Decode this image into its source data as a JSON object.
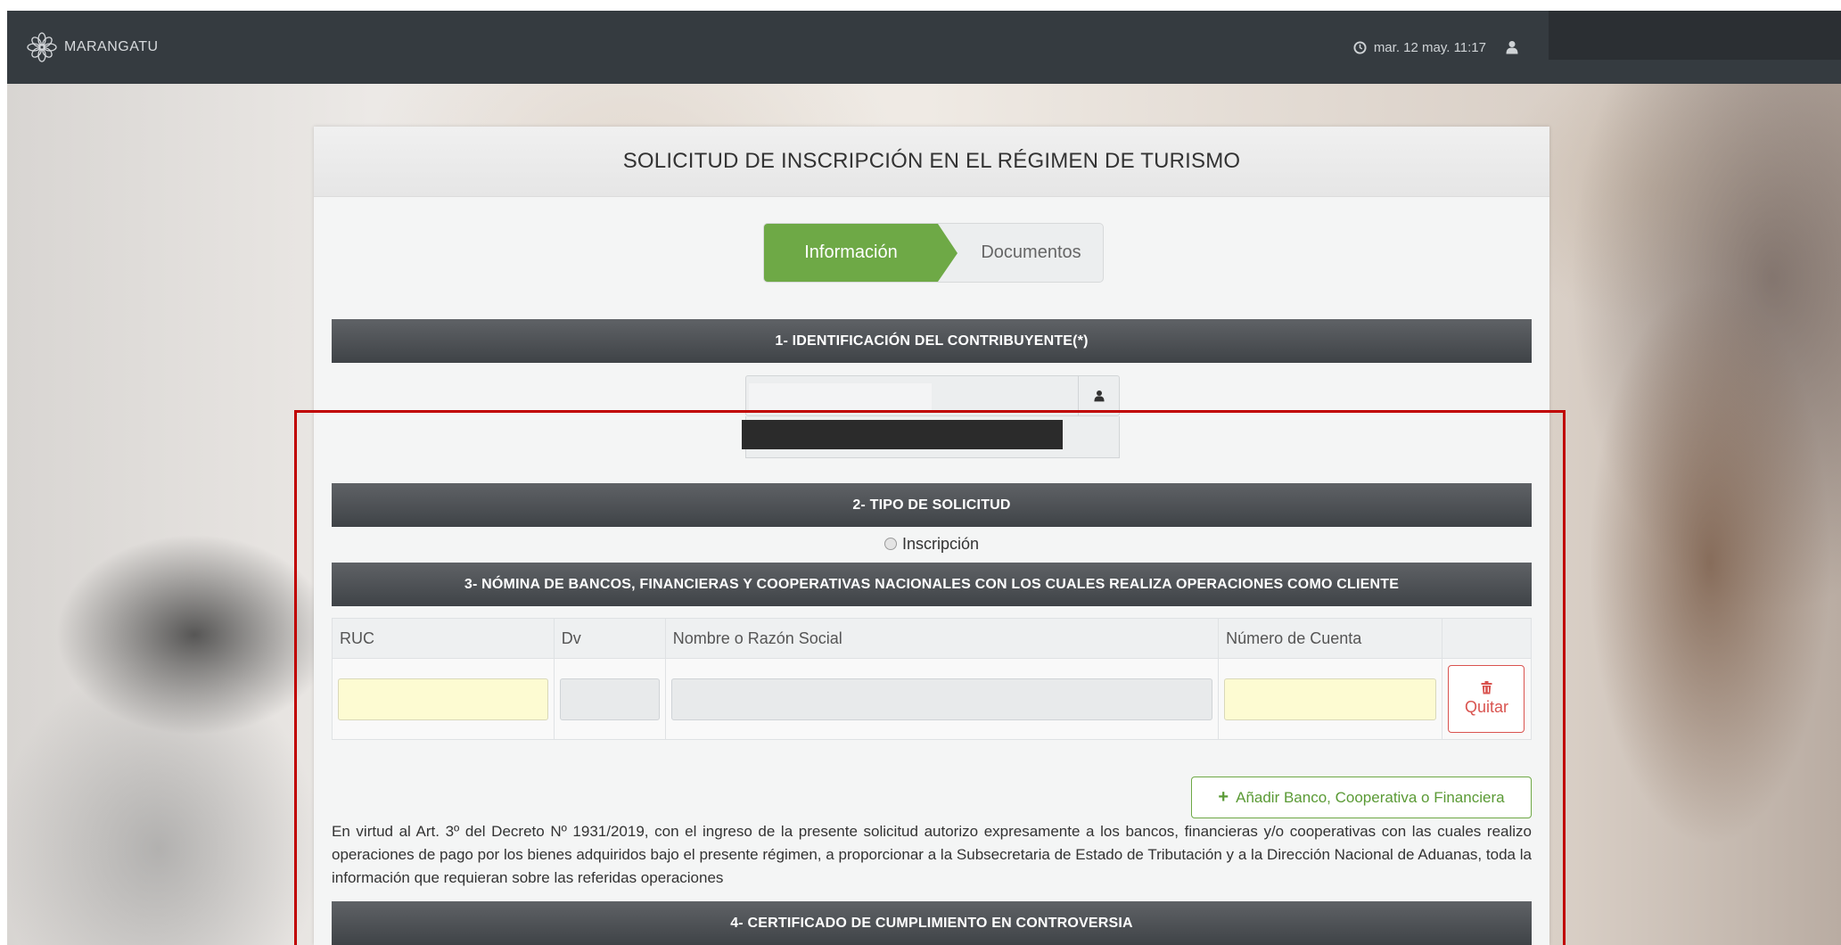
{
  "app": {
    "brand": "MARANGATU"
  },
  "header": {
    "datetime": "mar. 12 may. 11:17"
  },
  "form": {
    "title": "SOLICITUD DE INSCRIPCIÓN EN EL RÉGIMEN DE TURISMO",
    "steps": [
      {
        "label": "Información",
        "active": true
      },
      {
        "label": "Documentos",
        "active": false
      }
    ],
    "sections": {
      "s1": "1- IDENTIFICACIÓN DEL CONTRIBUYENTE(*)",
      "s2": "2- TIPO DE SOLICITUD",
      "s3": "3- NÓMINA DE BANCOS, FINANCIERAS Y COOPERATIVAS NACIONALES CON LOS CUALES REALIZA OPERACIONES COMO CLIENTE",
      "s4": "4- CERTIFICADO DE CUMPLIMIENTO EN CONTROVERSIA"
    },
    "tipo_solicitud": {
      "option": "Inscripción",
      "selected": false
    },
    "table": {
      "columns": [
        "RUC",
        "Dv",
        "Nombre o Razón Social",
        "Número de Cuenta"
      ],
      "remove_label": "Quitar"
    },
    "add_button": "Añadir Banco, Cooperativa o Financiera",
    "legal_text": "En virtud al Art. 3º del Decreto Nº 1931/2019, con el ingreso de la presente solicitud autorizo expresamente a los bancos, financieras y/o cooperativas con las cuales realizo operaciones de pago por los bienes adquiridos bajo el presente régimen, a proporcionar a la Subsecretaria de Estado de Tributación y a la Dirección Nacional de Aduanas, toda la información que requieran sobre las referidas operaciones"
  },
  "colors": {
    "topbar": "#353b40",
    "accent_green": "#6ea946",
    "danger": "#d9534f",
    "highlight_box": "#c00000"
  }
}
